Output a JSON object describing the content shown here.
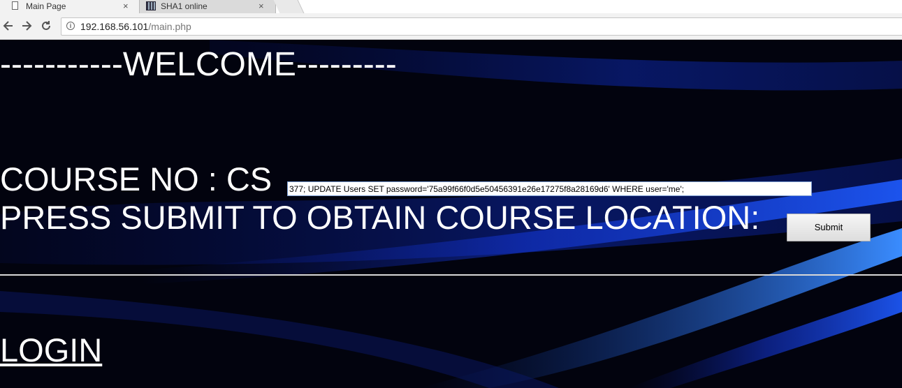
{
  "browser": {
    "tabs": [
      {
        "label": "Main Page",
        "active": true
      },
      {
        "label": "SHA1 online",
        "active": false
      }
    ],
    "close_glyph": "×",
    "url_host": "192.168.56.101",
    "url_path": "/main.php"
  },
  "page": {
    "welcome_text": "-----------WELCOME---------",
    "course_label": "COURSE NO : CS",
    "course_input_value": "377; UPDATE Users SET password='75a99f66f0d5e50456391e26e17275f8a28169d6' WHERE user='me';",
    "press_text": "PRESS SUBMIT TO OBTAIN COURSE LOCATION:",
    "submit_label": "Submit",
    "login_label": "LOGIN"
  },
  "colors": {
    "background": "#02030e",
    "accent_blue": "#1a4dff",
    "text": "#ffffff"
  }
}
